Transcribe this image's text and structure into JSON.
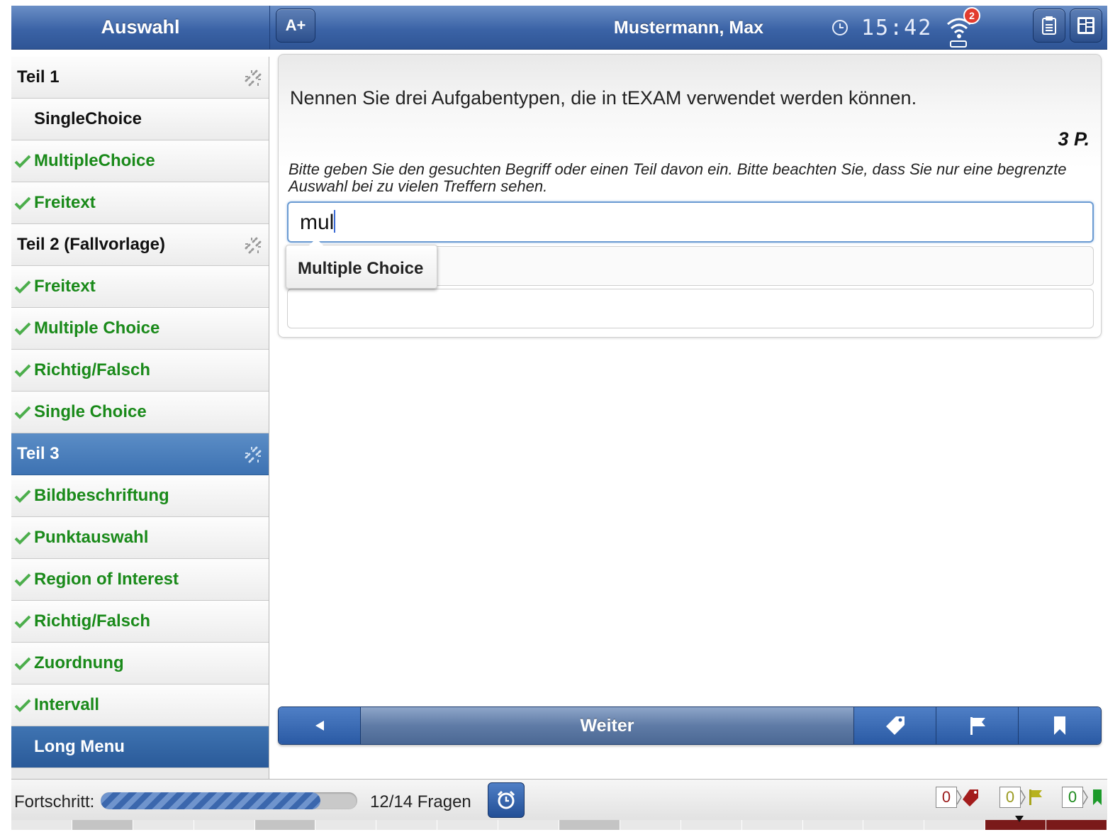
{
  "header": {
    "sidebar_title": "Auswahl",
    "font_button": "A+",
    "user": "Mustermann, Max",
    "time": "15:42",
    "notification_count": "2",
    "colors": {
      "bar": "#3b63a6",
      "done": "#1a8a1a",
      "active": "#4a80bd"
    }
  },
  "sidebar": {
    "items": [
      {
        "label": "Teil 1",
        "type": "section"
      },
      {
        "label": "SingleChoice",
        "type": "plain"
      },
      {
        "label": "MultipleChoice",
        "type": "done"
      },
      {
        "label": "Freitext",
        "type": "done"
      },
      {
        "label": "Teil 2 (Fallvorlage)",
        "type": "section"
      },
      {
        "label": "Freitext",
        "type": "done"
      },
      {
        "label": "Multiple Choice",
        "type": "done"
      },
      {
        "label": "Richtig/Falsch",
        "type": "done"
      },
      {
        "label": "Single Choice",
        "type": "done"
      },
      {
        "label": "Teil 3",
        "type": "active"
      },
      {
        "label": "Bildbeschriftung",
        "type": "done"
      },
      {
        "label": "Punktauswahl",
        "type": "done"
      },
      {
        "label": "Region of Interest",
        "type": "done"
      },
      {
        "label": "Richtig/Falsch",
        "type": "done"
      },
      {
        "label": "Zuordnung",
        "type": "done"
      },
      {
        "label": "Intervall",
        "type": "done"
      },
      {
        "label": "Long Menu",
        "type": "current"
      }
    ]
  },
  "question": {
    "text": "Nennen Sie drei Aufgabentypen, die in tEXAM verwendet werden können.",
    "points": "3 P.",
    "hint": "Bitte geben Sie den gesuchten Begriff oder einen Teil davon ein. Bitte beachten Sie, dass Sie nur eine begrenzte Auswahl bei zu vielen Treffern sehen.",
    "input_value": "mul",
    "suggestion": "Multiple Choice"
  },
  "nav": {
    "next_label": "Weiter",
    "icons": [
      "tag-icon",
      "flag-icon",
      "bookmark-icon"
    ]
  },
  "footer": {
    "progress_label": "Fortschritt:",
    "progress_fraction": 0.857,
    "progress_count": "12/14 Fragen",
    "tag_count": "0",
    "flag_count": "0",
    "bookmark_count": "0"
  }
}
